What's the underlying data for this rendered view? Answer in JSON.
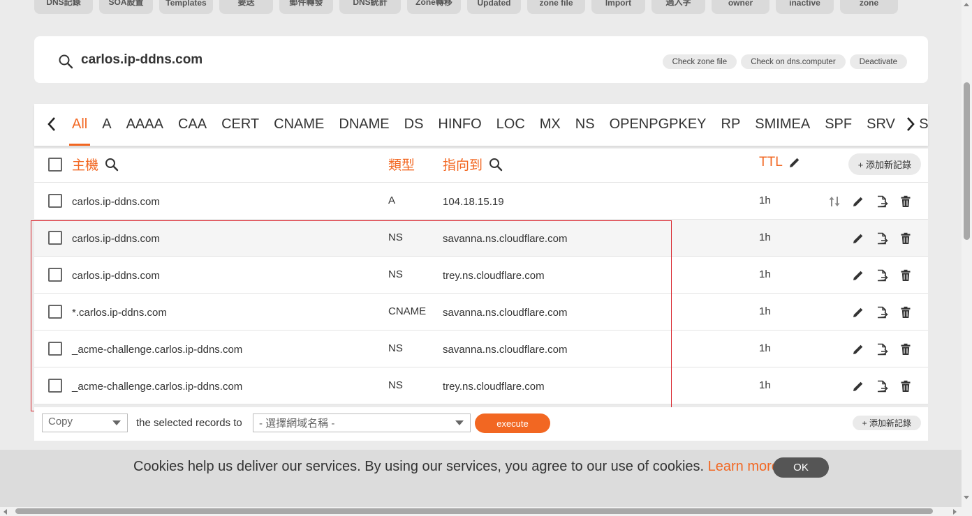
{
  "top_buttons": [
    "DNS記錄",
    "SOA設置",
    "Templates",
    "要送",
    "郵件轉發",
    "DNS統計",
    "Zone轉移",
    "Updated",
    "zone file",
    "Import",
    "過入字",
    "owner",
    "inactive",
    "zone"
  ],
  "header": {
    "domain": "carlos.ip-ddns.com",
    "actions": [
      "Check zone file",
      "Check on dns.computer",
      "Deactivate"
    ]
  },
  "tabs": {
    "active": "All",
    "items": [
      "All",
      "A",
      "AAAA",
      "CAA",
      "CERT",
      "CNAME",
      "DNAME",
      "DS",
      "HINFO",
      "LOC",
      "MX",
      "NS",
      "OPENPGPKEY",
      "RP",
      "SMIMEA",
      "SPF",
      "SRV",
      "SSHFP"
    ]
  },
  "table": {
    "columns": {
      "host": "主機",
      "type": "類型",
      "points_to": "指向到",
      "ttl": "TTL"
    },
    "add_label": "+ 添加新記錄",
    "rows": [
      {
        "host": "carlos.ip-ddns.com",
        "type": "A",
        "value": "104.18.15.19",
        "ttl": "1h"
      },
      {
        "host": "carlos.ip-ddns.com",
        "type": "NS",
        "value": "savanna.ns.cloudflare.com",
        "ttl": "1h"
      },
      {
        "host": "carlos.ip-ddns.com",
        "type": "NS",
        "value": "trey.ns.cloudflare.com",
        "ttl": "1h"
      },
      {
        "host": "*.carlos.ip-ddns.com",
        "type": "CNAME",
        "value": "savanna.ns.cloudflare.com",
        "ttl": "1h"
      },
      {
        "host": "_acme-challenge.carlos.ip-ddns.com",
        "type": "NS",
        "value": "savanna.ns.cloudflare.com",
        "ttl": "1h"
      },
      {
        "host": "_acme-challenge.carlos.ip-ddns.com",
        "type": "NS",
        "value": "trey.ns.cloudflare.com",
        "ttl": "1h"
      }
    ]
  },
  "bulk": {
    "action_value": "Copy",
    "label": "the selected records to",
    "target_placeholder": "- 選擇網域名稱 -",
    "execute_label": "execute",
    "add_label": "+ 添加新記錄"
  },
  "cookie": {
    "text": "Cookies help us deliver our services. By using our services, you agree to our use of cookies.",
    "link": "Learn more",
    "ok": "OK"
  },
  "colors": {
    "accent": "#f26722",
    "highlight": "#d9272e"
  }
}
